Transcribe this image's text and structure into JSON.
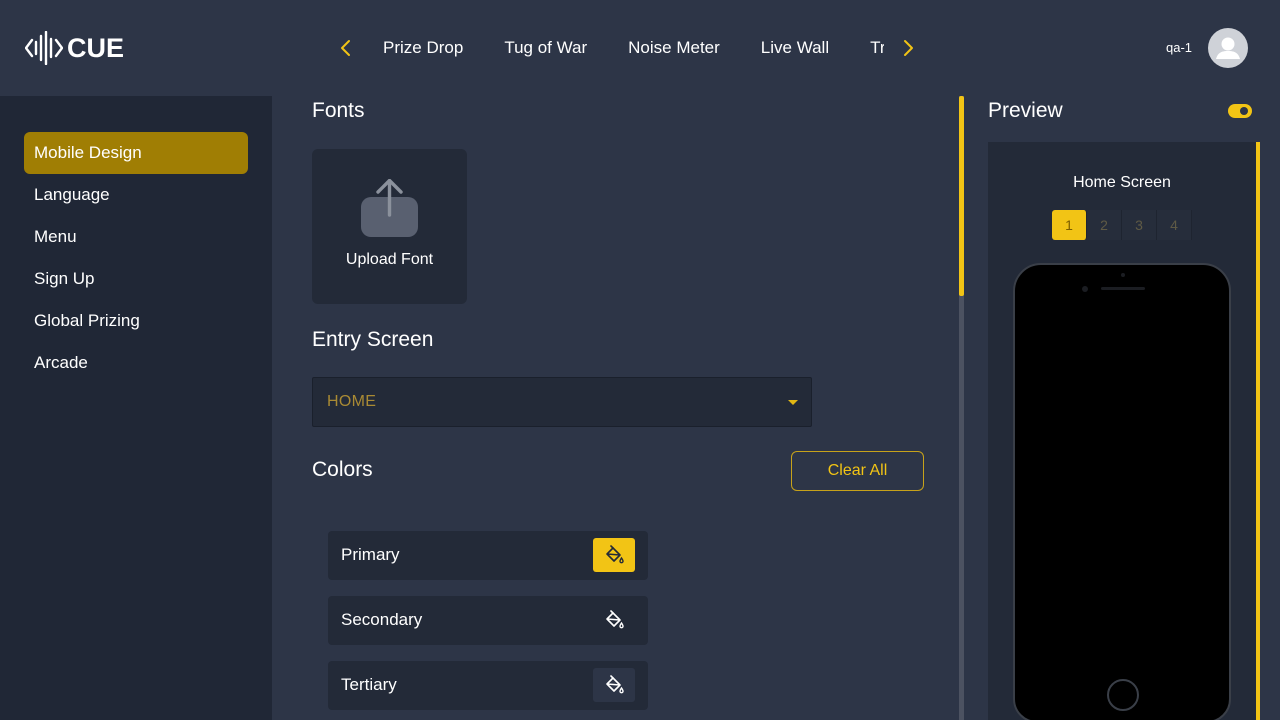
{
  "app": {
    "logo_text": "CUE"
  },
  "header": {
    "nav_items": [
      "Prize Drop",
      "Tug of War",
      "Noise Meter",
      "Live Wall",
      "Trivia"
    ],
    "user_name": "qa-1"
  },
  "sidebar": {
    "items": [
      {
        "label": "Mobile Design",
        "active": true
      },
      {
        "label": "Language",
        "active": false
      },
      {
        "label": "Menu",
        "active": false
      },
      {
        "label": "Sign Up",
        "active": false
      },
      {
        "label": "Global Prizing",
        "active": false
      },
      {
        "label": "Arcade",
        "active": false
      }
    ]
  },
  "main": {
    "fonts_title": "Fonts",
    "upload_font_label": "Upload Font",
    "entry_screen_title": "Entry Screen",
    "entry_screen_value": "HOME",
    "colors_title": "Colors",
    "clear_all_label": "Clear All",
    "colors": [
      {
        "label": "Primary",
        "icon": "paint-bucket-icon",
        "selected": true
      },
      {
        "label": "Secondary",
        "icon": "paint-bucket-icon",
        "selected": false
      },
      {
        "label": "Tertiary",
        "icon": "paint-bucket-icon",
        "selected": false
      }
    ]
  },
  "preview": {
    "title": "Preview",
    "toggle_on": true,
    "screen_name": "Home Screen",
    "pages": [
      "1",
      "2",
      "3",
      "4"
    ],
    "active_page": "1"
  },
  "theme": {
    "accent": "#f2c415",
    "active_nav_bg": "#a07e04",
    "sidebar_bg": "#202736",
    "body_bg": "#2d3547",
    "card_bg": "#232a38"
  }
}
